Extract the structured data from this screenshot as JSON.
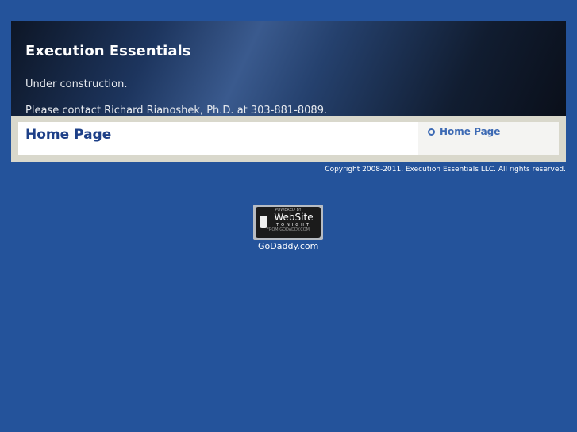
{
  "header": {
    "title": "Execution Essentials",
    "line1": "Under construction.",
    "line2": "Please contact Richard Rianoshek, Ph.D. at 303-881-8089."
  },
  "main": {
    "heading": "Home Page"
  },
  "sidebar": {
    "items": [
      {
        "label": "Home Page"
      }
    ]
  },
  "footer": {
    "copyright": "Copyright 2008-2011. Execution Essentials LLC. All rights reserved."
  },
  "badge": {
    "powered": "POWERED BY",
    "website": "WebSite",
    "tonight": "TONIGHT",
    "from": "FROM GODADDY.COM",
    "link": "GoDaddy.com"
  }
}
